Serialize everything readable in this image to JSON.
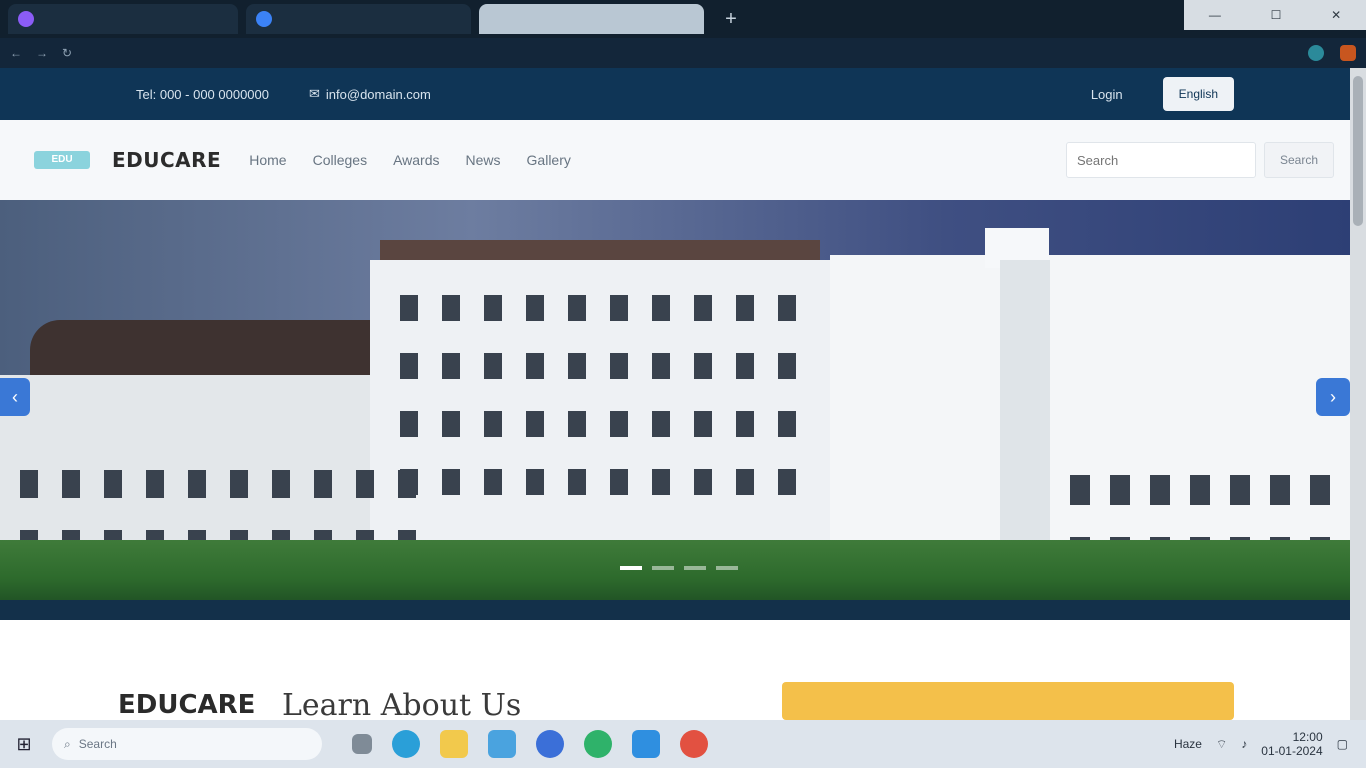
{
  "browser": {
    "tabs": [
      {
        "title": "",
        "favicon_color": "#8b5cf6"
      },
      {
        "title": "",
        "favicon_color": "#3b82f6"
      },
      {
        "title": "",
        "favicon_color": "#9aa9b6"
      }
    ],
    "new_tab": "+",
    "window_controls": {
      "minimize": "—",
      "maximize": "☐",
      "close": "✕"
    },
    "address": {
      "back": "←",
      "forward": "→",
      "reload": "↻",
      "url": ""
    }
  },
  "site": {
    "contact": {
      "phone": "Tel: 000 - 000 0000000",
      "email_icon": "envelope-icon",
      "email": "info@domain.com",
      "login": "Login",
      "language_button": "English"
    },
    "nav": {
      "logo_mark": "EDU",
      "logo_text": "EDUCARE",
      "links": [
        "Home",
        "Colleges",
        "Awards",
        "News",
        "Gallery"
      ],
      "search_placeholder": "Search",
      "search_button": "Search"
    },
    "hero": {
      "prev": "‹",
      "next": "›"
    },
    "about": {
      "brand": "EDUCARE",
      "title": "Learn About Us"
    }
  },
  "taskbar": {
    "start": "⊞",
    "search_placeholder": "Search",
    "time": "12:00",
    "date": "01-01-2024",
    "weather": "Haze"
  },
  "colors": {
    "brand_navy": "#0f3556",
    "accent_yellow": "#f4c04a",
    "logo_teal": "#8bd3dd"
  }
}
